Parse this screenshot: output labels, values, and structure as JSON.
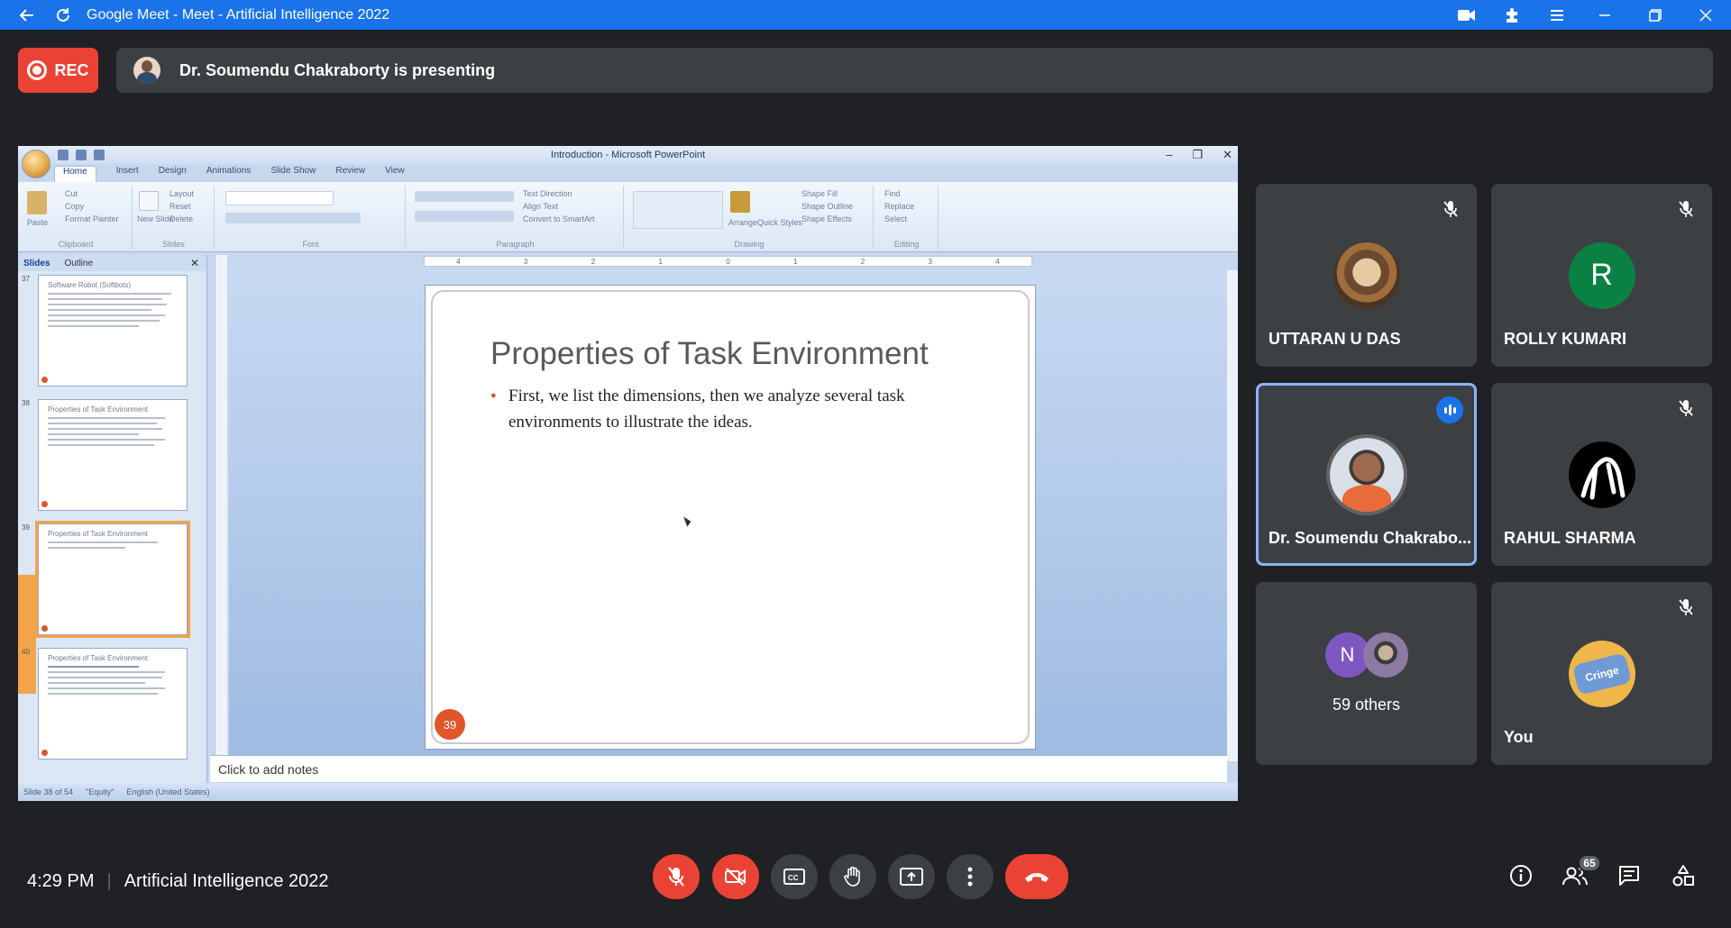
{
  "window": {
    "title": "Google Meet - Meet - Artificial Intelligence 2022"
  },
  "recording": {
    "label": "REC"
  },
  "presenting_banner": {
    "text": "Dr. Soumendu Chakraborty is presenting"
  },
  "shared_screen": {
    "window_title": "Introduction - Microsoft PowerPoint",
    "ribbon_tabs": [
      "Home",
      "Insert",
      "Design",
      "Animations",
      "Slide Show",
      "Review",
      "View"
    ],
    "ribbon_groups": [
      "Clipboard",
      "Slides",
      "Font",
      "Paragraph",
      "Drawing",
      "Editing"
    ],
    "clipboard": {
      "paste": "Paste",
      "cut": "Cut",
      "copy": "Copy",
      "format_painter": "Format Painter"
    },
    "slides_group": {
      "new_slide": "New Slide",
      "layout": "Layout",
      "reset": "Reset",
      "delete": "Delete"
    },
    "paragraph_group": {
      "text_direction": "Text Direction",
      "align_text": "Align Text",
      "smartart": "Convert to SmartArt"
    },
    "drawing_group": {
      "arrange": "Arrange",
      "quick_styles": "Quick Styles",
      "shape_fill": "Shape Fill",
      "shape_outline": "Shape Outline",
      "shape_effects": "Shape Effects"
    },
    "editing_group": {
      "find": "Find",
      "replace": "Replace",
      "select": "Select"
    },
    "panel_tabs": [
      "Slides",
      "Outline"
    ],
    "thumbnails": [
      {
        "number": "37",
        "title": "Software Robot (Softbots)"
      },
      {
        "number": "38",
        "title": "Properties of Task Environment"
      },
      {
        "number": "39",
        "title": "Properties of Task Environment"
      },
      {
        "number": "40",
        "title": "Properties of Task Environment"
      }
    ],
    "slide": {
      "title": "Properties of Task Environment",
      "bullet": "First, we list the dimensions, then we analyze several task environments to illustrate the ideas.",
      "number": "39"
    },
    "notes_placeholder": "Click to add notes",
    "status": {
      "slide": "Slide 38 of 54",
      "theme": "\"Equity\"",
      "language": "English (United States)"
    }
  },
  "participants": [
    {
      "name": "UTTARAN U DAS",
      "muted": true
    },
    {
      "name": "ROLLY KUMARI",
      "initial": "R",
      "muted": true
    },
    {
      "name": "Dr. Soumendu Chakrabo...",
      "speaking": true
    },
    {
      "name": "RAHUL SHARMA",
      "muted": true
    },
    {
      "name": "59 others",
      "initial": "N"
    },
    {
      "name": "You",
      "avatar_text": "Cringe",
      "muted": true
    }
  ],
  "meeting": {
    "time": "4:29 PM",
    "separator": "|",
    "name": "Artificial Intelligence 2022",
    "participant_count": "65"
  },
  "colors": {
    "title_bar": "#1a73e8",
    "background": "#202124",
    "tile": "#3c4043",
    "danger": "#ea4335",
    "speaking_border": "#8ab4f8",
    "avatar_green": "#0b8043",
    "avatar_purple": "#7e57c2",
    "slide_accent": "#e0552a"
  }
}
